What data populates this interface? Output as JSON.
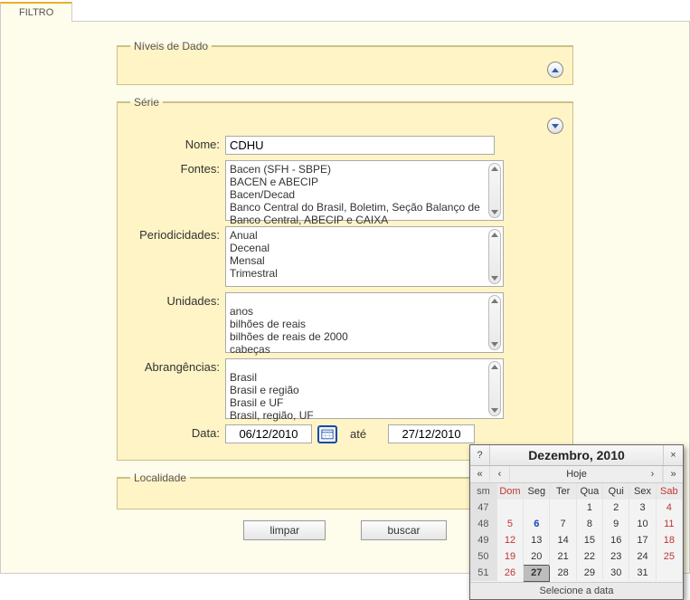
{
  "tab": {
    "label": "FILTRO"
  },
  "fieldsets": {
    "niveis": {
      "legend": "Níveis de Dado"
    },
    "serie": {
      "legend": "Série"
    },
    "localidade": {
      "legend": "Localidade"
    }
  },
  "labels": {
    "nome": "Nome:",
    "fontes": "Fontes:",
    "periodicidades": "Periodicidades:",
    "unidades": "Unidades:",
    "abrangencias": "Abrangências:",
    "data": "Data:",
    "ate": "até"
  },
  "serie": {
    "nome": "CDHU",
    "fontes": [
      "Bacen (SFH - SBPE)",
      "BACEN e ABECIP",
      "Bacen/Decad",
      "Banco Central do Brasil, Boletim, Seção Balanço de",
      "Banco Central, ABECIP e CAIXA"
    ],
    "periodicidades": [
      "Anual",
      "Decenal",
      "Mensal",
      "Trimestral"
    ],
    "unidades": [
      "anos",
      "bilhões de reais",
      "bilhões de reais de 2000",
      "cabeças"
    ],
    "abrangencias": [
      "Brasil",
      "Brasil e região",
      "Brasil e UF",
      "Brasil, região, UF"
    ],
    "data_de": "06/12/2010",
    "data_ate": "27/12/2010"
  },
  "buttons": {
    "limpar": "limpar",
    "buscar": "buscar"
  },
  "calendar": {
    "title": "Dezembro, 2010",
    "nav": {
      "help": "?",
      "close": "×",
      "first": "«",
      "prev": "‹",
      "today": "Hoje",
      "next": "›",
      "last": "»"
    },
    "sm": "sm",
    "day_heads": [
      "Dom",
      "Seg",
      "Ter",
      "Qua",
      "Qui",
      "Sex",
      "Sab"
    ],
    "weeks": [
      {
        "wk": "47",
        "d": [
          "",
          "",
          "",
          "1",
          "2",
          "3",
          "4"
        ]
      },
      {
        "wk": "48",
        "d": [
          "5",
          "6",
          "7",
          "8",
          "9",
          "10",
          "11"
        ]
      },
      {
        "wk": "49",
        "d": [
          "12",
          "13",
          "14",
          "15",
          "16",
          "17",
          "18"
        ]
      },
      {
        "wk": "50",
        "d": [
          "19",
          "20",
          "21",
          "22",
          "23",
          "24",
          "25"
        ]
      },
      {
        "wk": "51",
        "d": [
          "26",
          "27",
          "28",
          "29",
          "30",
          "31",
          ""
        ]
      }
    ],
    "selected": "27",
    "today_day": "6",
    "footer": "Selecione a data"
  }
}
